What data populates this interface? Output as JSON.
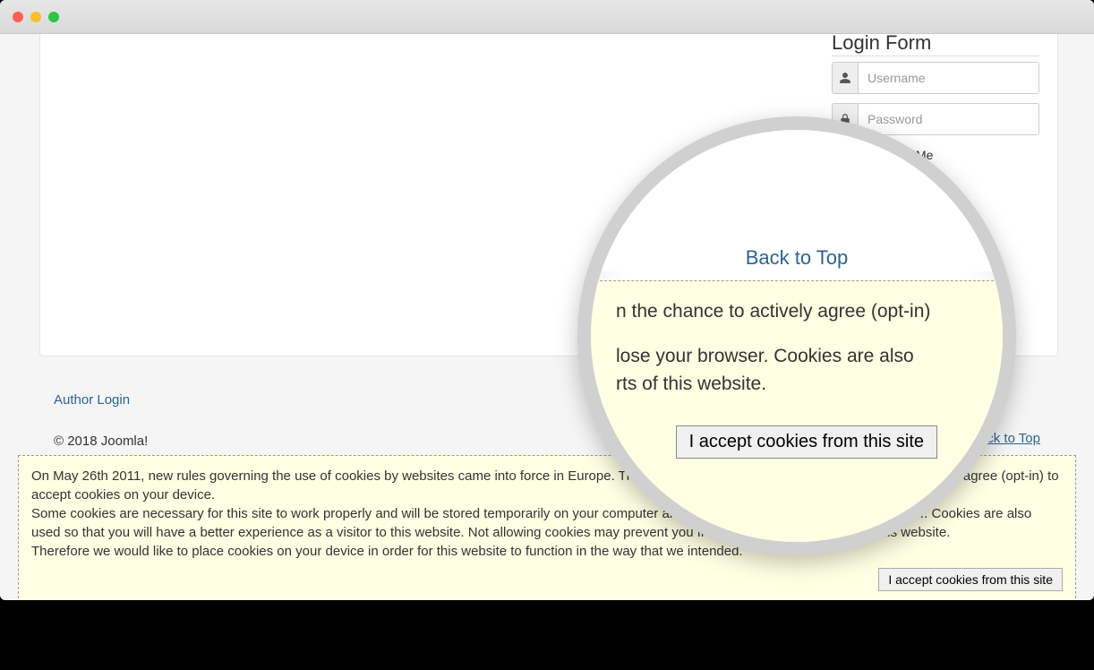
{
  "login": {
    "title": "Login Form",
    "username_placeholder": "Username",
    "password_placeholder": "Password",
    "remember_label": "Remember Me"
  },
  "footer": {
    "author_login": "Author Login",
    "copyright": "© 2018 Joomla!",
    "back_to_top": "Back to Top"
  },
  "cookie": {
    "text": "On May 26th 2011, new rules governing the use of cookies by websites came into force in Europe. This means that you must be given the chance to actively agree (opt-in) to accept cookies on your device.\nSome cookies are necessary for this site to work properly and will be stored temporarily on your computer and disappear when you close your browser. Cookies are also used so that you will have a better experience as a visitor to this website. Not allowing cookies may prevent you from accessing some parts of this website.\nTherefore we would like to place cookies on your device in order for this website to function in the way that we intended.",
    "button": "I accept cookies from this site"
  },
  "magnifier": {
    "back_to_top": "Back to Top",
    "line1": "n the chance to actively agree (opt-in)",
    "line2": "lose your browser. Cookies are also",
    "line3": "rts of this website.",
    "button": "I accept cookies from this site"
  }
}
